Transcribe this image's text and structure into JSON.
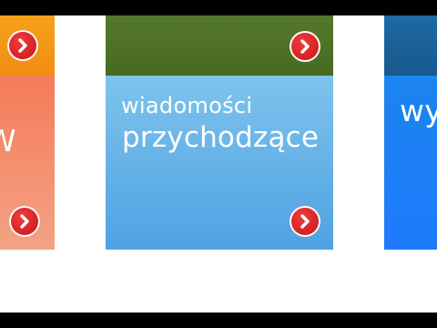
{
  "tiles": {
    "left": {
      "partial_label": "W"
    },
    "center": {
      "line1": "wiadomości",
      "line2": "przychodzące"
    },
    "right": {
      "partial_label": "wy"
    }
  },
  "icons": {
    "arrow": "chevron-right-icon"
  },
  "colors": {
    "left_head": "#f39417",
    "left_body": "#f3906e",
    "center_head": "#4f7326",
    "center_body": "#63b1e8",
    "right_head": "#1a6399",
    "right_body": "#1d80f5",
    "arrow": "#d62020"
  }
}
